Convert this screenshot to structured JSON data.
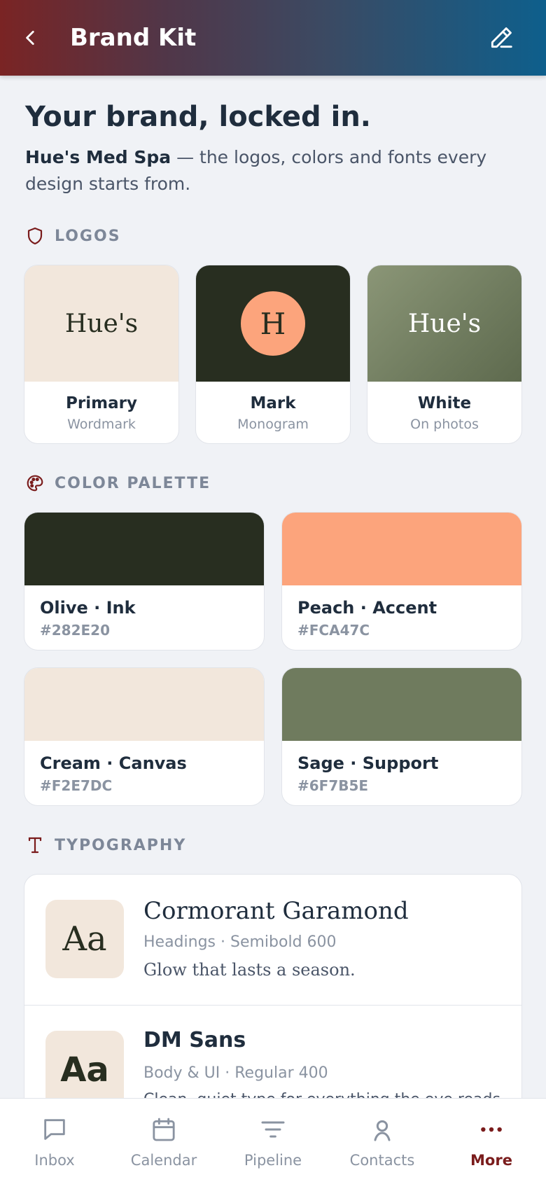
{
  "header": {
    "title": "Brand Kit"
  },
  "intro": {
    "title": "Your brand, locked in.",
    "brand_name": "Hue's Med Spa",
    "description": " — the logos, colors and fonts every design starts from."
  },
  "sections": {
    "logos": "LOGOS",
    "palette": "COLOR PALETTE",
    "typography": "TYPOGRAPHY"
  },
  "logos": [
    {
      "preview": "Hue's",
      "name": "Primary",
      "sub": "Wordmark"
    },
    {
      "preview": "H",
      "name": "Mark",
      "sub": "Monogram"
    },
    {
      "preview": "Hue's",
      "name": "White",
      "sub": "On photos"
    }
  ],
  "palette": [
    {
      "name": "Olive · Ink",
      "hex": "#282E20",
      "color": "#282E20"
    },
    {
      "name": "Peach · Accent",
      "hex": "#FCA47C",
      "color": "#FCA47C"
    },
    {
      "name": "Cream · Canvas",
      "hex": "#F2E7DC",
      "color": "#F2E7DC"
    },
    {
      "name": "Sage · Support",
      "hex": "#6F7B5E",
      "color": "#6F7B5E"
    }
  ],
  "typography": [
    {
      "sample_glyph": "Aa",
      "name": "Cormorant Garamond",
      "meta": "Headings · Semibold 600",
      "sample": "Glow that lasts a season."
    },
    {
      "sample_glyph": "Aa",
      "name": "DM Sans",
      "meta": "Body & UI · Regular 400",
      "sample": "Clean, quiet type for everything the eye reads."
    }
  ],
  "tabs": [
    {
      "label": "Inbox",
      "icon": "chat-bubble-icon"
    },
    {
      "label": "Calendar",
      "icon": "calendar-icon"
    },
    {
      "label": "Pipeline",
      "icon": "filter-lines-icon"
    },
    {
      "label": "Contacts",
      "icon": "person-icon"
    },
    {
      "label": "More",
      "icon": "more-dots-icon",
      "active": true
    }
  ],
  "colors": {
    "accent": "#7A1C1C",
    "header_start": "#7A2424",
    "header_end": "#0E5F8C",
    "muted": "#8A93A1"
  }
}
